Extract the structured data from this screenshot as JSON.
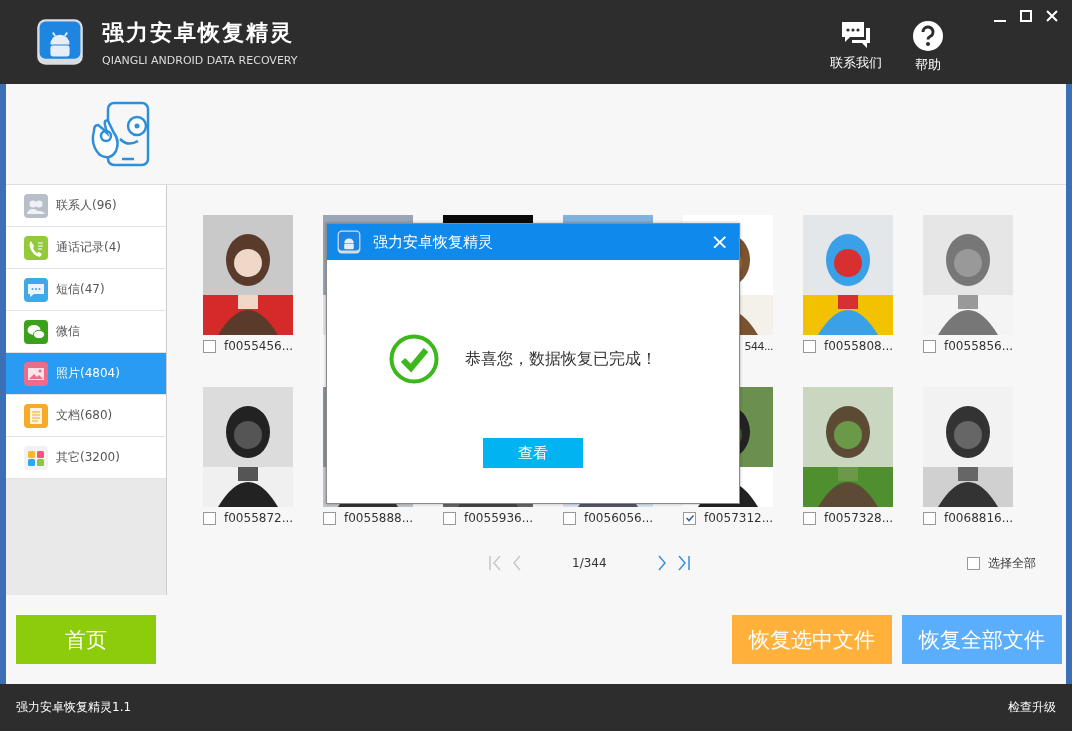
{
  "window": {
    "title": "强力安卓恢复精灵",
    "subtitle": "QIANGLI ANDROID DATA RECOVERY"
  },
  "header_actions": [
    {
      "kind": "contact",
      "label": "联系我们"
    },
    {
      "kind": "help",
      "label": "帮助"
    }
  ],
  "sidebar": {
    "items": [
      {
        "kind": "contacts",
        "label": "联系人(96)",
        "selected": false
      },
      {
        "kind": "calls",
        "label": "通话记录(4)",
        "selected": false
      },
      {
        "kind": "sms",
        "label": "短信(47)",
        "selected": false
      },
      {
        "kind": "wechat",
        "label": "微信",
        "selected": false
      },
      {
        "kind": "photos",
        "label": "照片(4804)",
        "selected": true
      },
      {
        "kind": "docs",
        "label": "文档(680)",
        "selected": false
      },
      {
        "kind": "other",
        "label": "其它(3200)",
        "selected": false
      }
    ]
  },
  "photos": [
    {
      "kind": "picture",
      "label": "f0055456...",
      "checked": false
    },
    {
      "kind": "picture"
    },
    {
      "kind": "picture"
    },
    {
      "kind": "picture"
    },
    {
      "kind": "picture",
      "label": "544..."
    },
    {
      "kind": "picture",
      "label": "f0055808...",
      "checked": false
    },
    {
      "kind": "picture",
      "label": "f0055856...",
      "checked": false
    },
    {
      "kind": "picture",
      "label": "f0055872...",
      "checked": false
    },
    {
      "kind": "picture",
      "label": "f0055888...",
      "checked": false
    },
    {
      "kind": "picture",
      "label": "f0055936...",
      "checked": false
    },
    {
      "kind": "picture",
      "label": "f0056056...",
      "checked": false
    },
    {
      "kind": "picture",
      "label": "f0057312...",
      "checked": true
    },
    {
      "kind": "picture",
      "label": "f0057328...",
      "checked": false
    },
    {
      "kind": "picture",
      "label": "f0068816...",
      "checked": false
    }
  ],
  "pagination": {
    "page": "1/344"
  },
  "select_all": {
    "label": "选择全部",
    "checked": false
  },
  "buttons": {
    "home": "首页",
    "recover_selected": "恢复选中文件",
    "recover_all": "恢复全部文件"
  },
  "dialog": {
    "title": "强力安卓恢复精灵",
    "close": "×",
    "message": "恭喜您，数据恢复已完成！",
    "button": "查看"
  },
  "status_bar": {
    "version": "强力安卓恢复精灵1.1",
    "update": "检查升级"
  }
}
